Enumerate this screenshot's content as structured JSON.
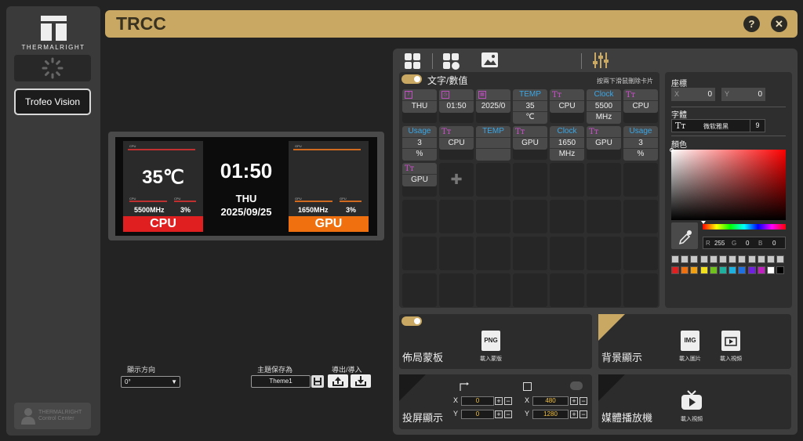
{
  "app": {
    "title": "TRCC",
    "brand": "THERMALRIGHT"
  },
  "header": {
    "help_label": "?",
    "close_label": "✕"
  },
  "sidebar": {
    "device_label": "Trofeo Vision",
    "tcc_line1": "THERMALRIGHT",
    "tcc_line2": "Control Center"
  },
  "preview": {
    "cpu": {
      "temp": "35℃",
      "freq": "5500MHz",
      "usage": "3%",
      "label": "CPU",
      "color": "#e02020"
    },
    "gpu": {
      "freq": "1650MHz",
      "usage": "3%",
      "label": "GPU",
      "color": "#f07010"
    },
    "time": "01:50",
    "day": "THU",
    "date": "2025/09/25",
    "tiny_cpu": "CPU",
    "tiny_gpu": "GPU"
  },
  "controls": {
    "orientation_label": "顯示方向",
    "orientation_value": "0°",
    "theme_label": "主題保存為",
    "theme_value": "Theme1",
    "export_label": "導出/導入"
  },
  "panel": {
    "section_title": "文字/數值",
    "hint": "按兩下滑鼠刪除卡片",
    "widgets": [
      {
        "head": "7",
        "lines": [
          "THU"
        ]
      },
      {
        "head": "◷",
        "lines": [
          "01:50"
        ]
      },
      {
        "head": "▦",
        "lines": [
          "2025/0"
        ]
      },
      {
        "head": "TEMP",
        "lines": [
          "35",
          "℃"
        ]
      },
      {
        "head": "TT",
        "lines": [
          "CPU"
        ]
      },
      {
        "head": "Clock",
        "lines": [
          "5500",
          "MHz"
        ]
      },
      {
        "head": "TT",
        "lines": [
          "CPU"
        ]
      },
      {
        "head": "Usage",
        "lines": [
          "3",
          "%"
        ]
      },
      {
        "head": "TT",
        "lines": [
          "CPU"
        ]
      },
      {
        "head": "TEMP",
        "lines": [
          "",
          ""
        ]
      },
      {
        "head": "TT",
        "lines": [
          "GPU"
        ]
      },
      {
        "head": "Clock",
        "lines": [
          "1650",
          "MHz"
        ]
      },
      {
        "head": "TT",
        "lines": [
          "GPU"
        ]
      },
      {
        "head": "Usage",
        "lines": [
          "3",
          "%"
        ]
      },
      {
        "head": "TT",
        "lines": [
          "GPU"
        ]
      }
    ],
    "add_label": "✚"
  },
  "props": {
    "coords_label": "座標",
    "x_label": "X",
    "x_value": "0",
    "y_label": "Y",
    "y_value": "0",
    "font_label": "字體",
    "font_name": "微软雅黑",
    "font_size": "9",
    "color_label": "顏色",
    "r_label": "R",
    "r_value": "255",
    "g_label": "G",
    "g_value": "0",
    "b_label": "B",
    "b_value": "0",
    "swatches_gray": [
      "#c8c8c8",
      "#c8c8c8",
      "#c8c8c8",
      "#c8c8c8",
      "#c8c8c8",
      "#c8c8c8",
      "#c8c8c8",
      "#c8c8c8",
      "#c8c8c8",
      "#c8c8c8",
      "#c8c8c8",
      "#c8c8c8"
    ],
    "swatches_color": [
      "#e02020",
      "#f07010",
      "#f0a010",
      "#f0e020",
      "#70c020",
      "#20b0a0",
      "#20b0e0",
      "#2070e0",
      "#7020e0",
      "#c020c0",
      "#ffffff",
      "#000000"
    ]
  },
  "layout_mask": {
    "title": "佈局蒙板",
    "png": "PNG",
    "sub": "載入蒙版"
  },
  "background": {
    "title": "背景顯示",
    "img": "IMG",
    "sub_img": "載入圖片",
    "sub_video": "載入視頻"
  },
  "projection": {
    "title": "投屏顯示",
    "x1_label": "X",
    "x1_value": "0",
    "y1_label": "Y",
    "y1_value": "0",
    "x2_label": "X",
    "x2_value": "480",
    "y2_label": "Y",
    "y2_value": "1280"
  },
  "media": {
    "title": "媒體播放機",
    "sub": "載入視頻"
  }
}
